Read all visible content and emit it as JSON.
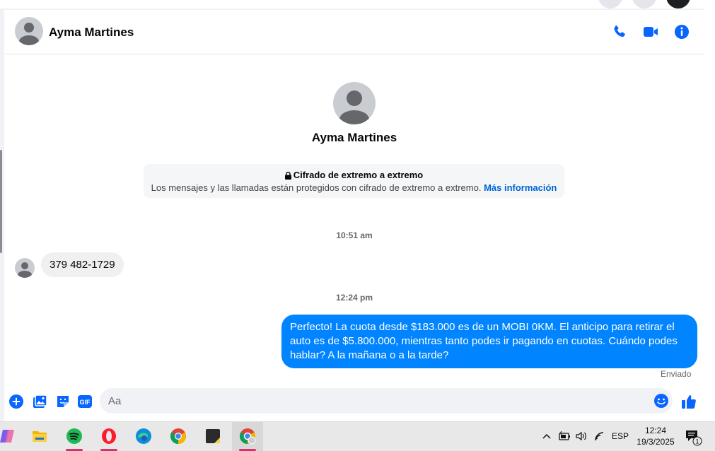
{
  "header": {
    "contact_name": "Ayma Martines",
    "actions": [
      "phone-call",
      "video-call",
      "conversation-info"
    ]
  },
  "profile": {
    "name": "Ayma Martines"
  },
  "encryption": {
    "title": "Cifrado de extremo a extremo",
    "text": "Los mensajes y las llamadas están protegidos con cifrado de extremo a extremo.",
    "link": "Más información"
  },
  "messages": [
    {
      "timestamp": "10:51 am",
      "direction": "in",
      "text": "379 482-1729"
    },
    {
      "timestamp": "12:24 pm",
      "direction": "out",
      "text": "Perfecto! La cuota desde $183.000 es de un MOBI 0KM. El anticipo para retirar el auto es de $5.800.000, mientras tanto podes ir pagando en cuotas. Cuándo podes hablar? A la mañana o a la tarde?",
      "status": "Enviado"
    }
  ],
  "composer": {
    "placeholder": "Aa",
    "gif_label": "GIF"
  },
  "taskbar": {
    "apps": [
      "copilot",
      "file-explorer",
      "spotify",
      "opera",
      "edge",
      "chrome",
      "sticky-notes",
      "chrome-profile"
    ],
    "language": "ESP",
    "time": "12:24",
    "date": "19/3/2025",
    "notification_count": "1"
  },
  "colors": {
    "accent": "#0084ff",
    "icon_blue": "#0866ff",
    "incoming_bubble": "#f0f0f0"
  }
}
